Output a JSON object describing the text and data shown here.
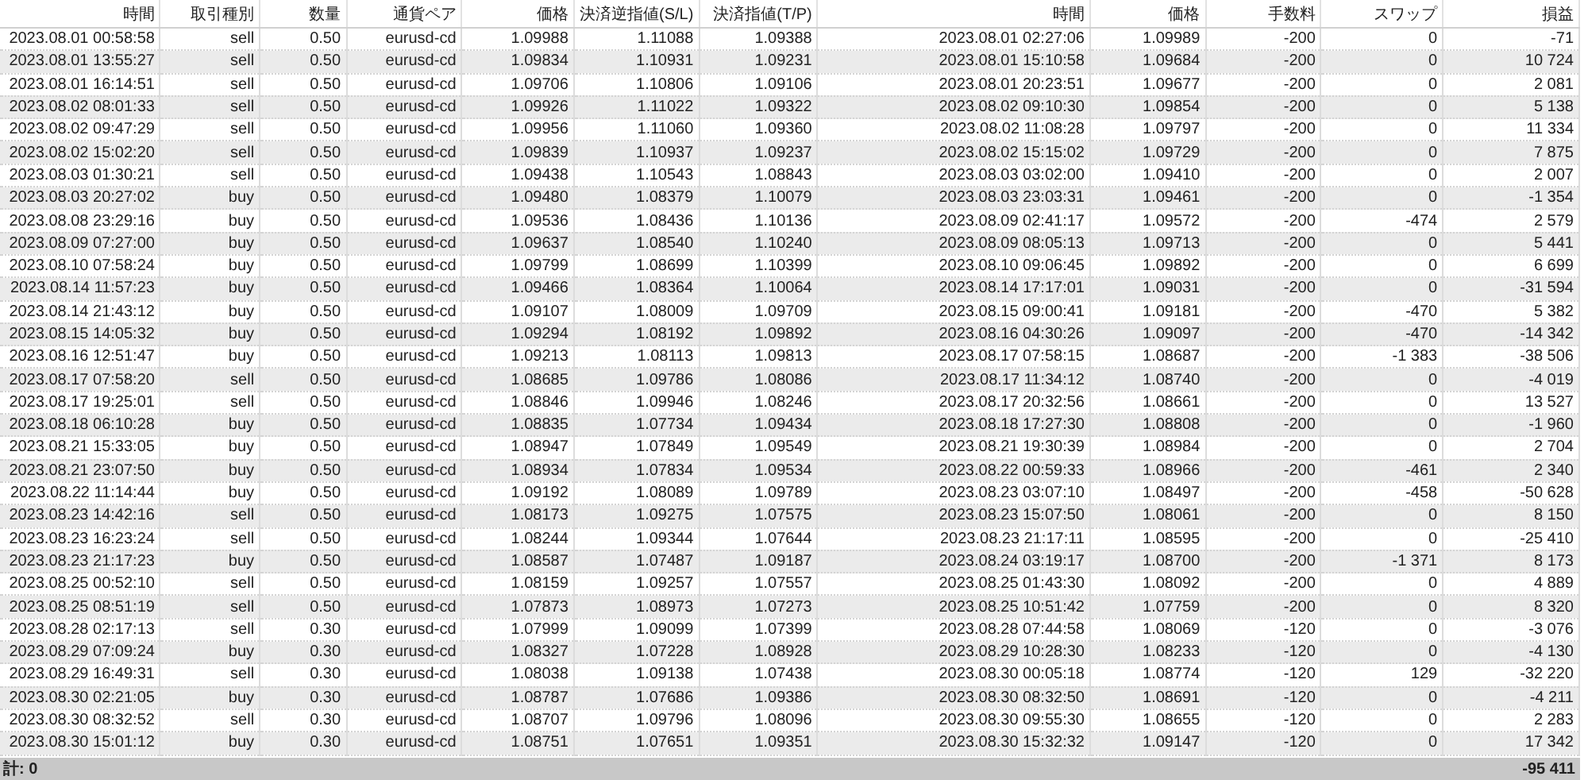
{
  "table": {
    "columns": [
      "時間",
      "取引種別",
      "数量",
      "通貨ペア",
      "価格",
      "決済逆指値(S/L)",
      "決済指値(T/P)",
      "時間",
      "価格",
      "手数料",
      "スワップ",
      "損益"
    ],
    "rows": [
      [
        "2023.08.01 00:58:58",
        "sell",
        "0.50",
        "eurusd-cd",
        "1.09988",
        "1.11088",
        "1.09388",
        "2023.08.01 02:27:06",
        "1.09989",
        "-200",
        "0",
        "-71"
      ],
      [
        "2023.08.01 13:55:27",
        "sell",
        "0.50",
        "eurusd-cd",
        "1.09834",
        "1.10931",
        "1.09231",
        "2023.08.01 15:10:58",
        "1.09684",
        "-200",
        "0",
        "10 724"
      ],
      [
        "2023.08.01 16:14:51",
        "sell",
        "0.50",
        "eurusd-cd",
        "1.09706",
        "1.10806",
        "1.09106",
        "2023.08.01 20:23:51",
        "1.09677",
        "-200",
        "0",
        "2 081"
      ],
      [
        "2023.08.02 08:01:33",
        "sell",
        "0.50",
        "eurusd-cd",
        "1.09926",
        "1.11022",
        "1.09322",
        "2023.08.02 09:10:30",
        "1.09854",
        "-200",
        "0",
        "5 138"
      ],
      [
        "2023.08.02 09:47:29",
        "sell",
        "0.50",
        "eurusd-cd",
        "1.09956",
        "1.11060",
        "1.09360",
        "2023.08.02 11:08:28",
        "1.09797",
        "-200",
        "0",
        "11 334"
      ],
      [
        "2023.08.02 15:02:20",
        "sell",
        "0.50",
        "eurusd-cd",
        "1.09839",
        "1.10937",
        "1.09237",
        "2023.08.02 15:15:02",
        "1.09729",
        "-200",
        "0",
        "7 875"
      ],
      [
        "2023.08.03 01:30:21",
        "sell",
        "0.50",
        "eurusd-cd",
        "1.09438",
        "1.10543",
        "1.08843",
        "2023.08.03 03:02:00",
        "1.09410",
        "-200",
        "0",
        "2 007"
      ],
      [
        "2023.08.03 20:27:02",
        "buy",
        "0.50",
        "eurusd-cd",
        "1.09480",
        "1.08379",
        "1.10079",
        "2023.08.03 23:03:31",
        "1.09461",
        "-200",
        "0",
        "-1 354"
      ],
      [
        "2023.08.08 23:29:16",
        "buy",
        "0.50",
        "eurusd-cd",
        "1.09536",
        "1.08436",
        "1.10136",
        "2023.08.09 02:41:17",
        "1.09572",
        "-200",
        "-474",
        "2 579"
      ],
      [
        "2023.08.09 07:27:00",
        "buy",
        "0.50",
        "eurusd-cd",
        "1.09637",
        "1.08540",
        "1.10240",
        "2023.08.09 08:05:13",
        "1.09713",
        "-200",
        "0",
        "5 441"
      ],
      [
        "2023.08.10 07:58:24",
        "buy",
        "0.50",
        "eurusd-cd",
        "1.09799",
        "1.08699",
        "1.10399",
        "2023.08.10 09:06:45",
        "1.09892",
        "-200",
        "0",
        "6 699"
      ],
      [
        "2023.08.14 11:57:23",
        "buy",
        "0.50",
        "eurusd-cd",
        "1.09466",
        "1.08364",
        "1.10064",
        "2023.08.14 17:17:01",
        "1.09031",
        "-200",
        "0",
        "-31 594"
      ],
      [
        "2023.08.14 21:43:12",
        "buy",
        "0.50",
        "eurusd-cd",
        "1.09107",
        "1.08009",
        "1.09709",
        "2023.08.15 09:00:41",
        "1.09181",
        "-200",
        "-470",
        "5 382"
      ],
      [
        "2023.08.15 14:05:32",
        "buy",
        "0.50",
        "eurusd-cd",
        "1.09294",
        "1.08192",
        "1.09892",
        "2023.08.16 04:30:26",
        "1.09097",
        "-200",
        "-470",
        "-14 342"
      ],
      [
        "2023.08.16 12:51:47",
        "buy",
        "0.50",
        "eurusd-cd",
        "1.09213",
        "1.08113",
        "1.09813",
        "2023.08.17 07:58:15",
        "1.08687",
        "-200",
        "-1 383",
        "-38 506"
      ],
      [
        "2023.08.17 07:58:20",
        "sell",
        "0.50",
        "eurusd-cd",
        "1.08685",
        "1.09786",
        "1.08086",
        "2023.08.17 11:34:12",
        "1.08740",
        "-200",
        "0",
        "-4 019"
      ],
      [
        "2023.08.17 19:25:01",
        "sell",
        "0.50",
        "eurusd-cd",
        "1.08846",
        "1.09946",
        "1.08246",
        "2023.08.17 20:32:56",
        "1.08661",
        "-200",
        "0",
        "13 527"
      ],
      [
        "2023.08.18 06:10:28",
        "buy",
        "0.50",
        "eurusd-cd",
        "1.08835",
        "1.07734",
        "1.09434",
        "2023.08.18 17:27:30",
        "1.08808",
        "-200",
        "0",
        "-1 960"
      ],
      [
        "2023.08.21 15:33:05",
        "buy",
        "0.50",
        "eurusd-cd",
        "1.08947",
        "1.07849",
        "1.09549",
        "2023.08.21 19:30:39",
        "1.08984",
        "-200",
        "0",
        "2 704"
      ],
      [
        "2023.08.21 23:07:50",
        "buy",
        "0.50",
        "eurusd-cd",
        "1.08934",
        "1.07834",
        "1.09534",
        "2023.08.22 00:59:33",
        "1.08966",
        "-200",
        "-461",
        "2 340"
      ],
      [
        "2023.08.22 11:14:44",
        "buy",
        "0.50",
        "eurusd-cd",
        "1.09192",
        "1.08089",
        "1.09789",
        "2023.08.23 03:07:10",
        "1.08497",
        "-200",
        "-458",
        "-50 628"
      ],
      [
        "2023.08.23 14:42:16",
        "sell",
        "0.50",
        "eurusd-cd",
        "1.08173",
        "1.09275",
        "1.07575",
        "2023.08.23 15:07:50",
        "1.08061",
        "-200",
        "0",
        "8 150"
      ],
      [
        "2023.08.23 16:23:24",
        "sell",
        "0.50",
        "eurusd-cd",
        "1.08244",
        "1.09344",
        "1.07644",
        "2023.08.23 21:17:11",
        "1.08595",
        "-200",
        "0",
        "-25 410"
      ],
      [
        "2023.08.23 21:17:23",
        "buy",
        "0.50",
        "eurusd-cd",
        "1.08587",
        "1.07487",
        "1.09187",
        "2023.08.24 03:19:17",
        "1.08700",
        "-200",
        "-1 371",
        "8 173"
      ],
      [
        "2023.08.25 00:52:10",
        "sell",
        "0.50",
        "eurusd-cd",
        "1.08159",
        "1.09257",
        "1.07557",
        "2023.08.25 01:43:30",
        "1.08092",
        "-200",
        "0",
        "4 889"
      ],
      [
        "2023.08.25 08:51:19",
        "sell",
        "0.50",
        "eurusd-cd",
        "1.07873",
        "1.08973",
        "1.07273",
        "2023.08.25 10:51:42",
        "1.07759",
        "-200",
        "0",
        "8 320"
      ],
      [
        "2023.08.28 02:17:13",
        "sell",
        "0.30",
        "eurusd-cd",
        "1.07999",
        "1.09099",
        "1.07399",
        "2023.08.28 07:44:58",
        "1.08069",
        "-120",
        "0",
        "-3 076"
      ],
      [
        "2023.08.29 07:09:24",
        "buy",
        "0.30",
        "eurusd-cd",
        "1.08327",
        "1.07228",
        "1.08928",
        "2023.08.29 10:28:30",
        "1.08233",
        "-120",
        "0",
        "-4 130"
      ],
      [
        "2023.08.29 16:49:31",
        "sell",
        "0.30",
        "eurusd-cd",
        "1.08038",
        "1.09138",
        "1.07438",
        "2023.08.30 00:05:18",
        "1.08774",
        "-120",
        "129",
        "-32 220"
      ],
      [
        "2023.08.30 02:21:05",
        "buy",
        "0.30",
        "eurusd-cd",
        "1.08787",
        "1.07686",
        "1.09386",
        "2023.08.30 08:32:50",
        "1.08691",
        "-120",
        "0",
        "-4 211"
      ],
      [
        "2023.08.30 08:32:52",
        "sell",
        "0.30",
        "eurusd-cd",
        "1.08707",
        "1.09796",
        "1.08096",
        "2023.08.30 09:55:30",
        "1.08655",
        "-120",
        "0",
        "2 283"
      ],
      [
        "2023.08.30 15:01:12",
        "buy",
        "0.30",
        "eurusd-cd",
        "1.08751",
        "1.07651",
        "1.09351",
        "2023.08.30 15:32:32",
        "1.09147",
        "-120",
        "0",
        "17 342"
      ]
    ]
  },
  "summary": {
    "label": "計: 0",
    "total": "-95 411"
  }
}
